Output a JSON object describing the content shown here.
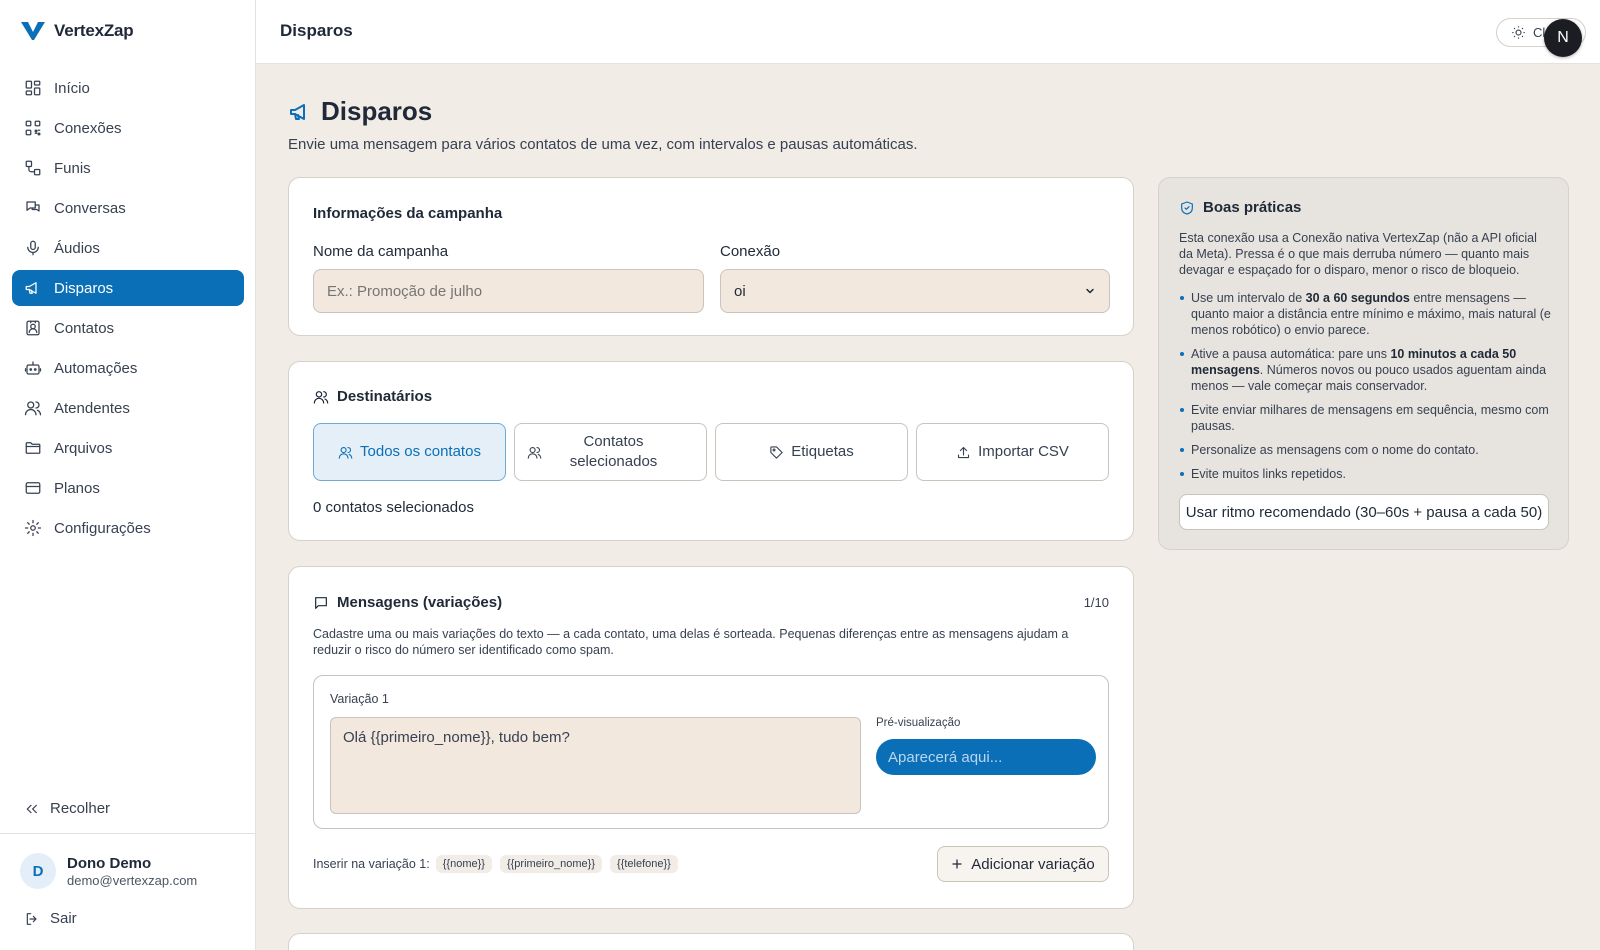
{
  "brand": {
    "name": "VertexZap"
  },
  "sidebar": {
    "items": [
      {
        "label": "Início",
        "icon": "dashboard-icon"
      },
      {
        "label": "Conexões",
        "icon": "qrcode-icon"
      },
      {
        "label": "Funis",
        "icon": "workflow-icon"
      },
      {
        "label": "Conversas",
        "icon": "chat-icon"
      },
      {
        "label": "Áudios",
        "icon": "microphone-icon"
      },
      {
        "label": "Disparos",
        "icon": "megaphone-icon",
        "active": true
      },
      {
        "label": "Contatos",
        "icon": "contact-card-icon"
      },
      {
        "label": "Automações",
        "icon": "bot-icon"
      },
      {
        "label": "Atendentes",
        "icon": "users-icon"
      },
      {
        "label": "Arquivos",
        "icon": "folder-icon"
      },
      {
        "label": "Planos",
        "icon": "credit-card-icon"
      },
      {
        "label": "Configurações",
        "icon": "gear-icon"
      }
    ],
    "collapse_label": "Recolher",
    "user": {
      "initial": "D",
      "name": "Dono Demo",
      "email": "demo@vertexzap.com"
    },
    "logout_label": "Sair"
  },
  "header": {
    "title": "Disparos",
    "theme_button_label": "Cl",
    "user_initial": "N"
  },
  "page": {
    "title": "Disparos",
    "subtitle": "Envie uma mensagem para vários contatos de uma vez, com intervalos e pausas automáticas."
  },
  "campaign": {
    "title": "Informações da campanha",
    "name_label": "Nome da campanha",
    "name_placeholder": "Ex.: Promoção de julho",
    "connection_label": "Conexão",
    "connection_value": "oi"
  },
  "recipients": {
    "title": "Destinatários",
    "options": [
      {
        "label": "Todos os contatos",
        "active": true
      },
      {
        "label": "Contatos selecionados",
        "active": false
      },
      {
        "label": "Etiquetas",
        "active": false
      },
      {
        "label": "Importar CSV",
        "active": false
      }
    ],
    "count_text": "0 contatos selecionados"
  },
  "messages": {
    "title": "Mensagens (variações)",
    "counter": "1/10",
    "description": "Cadastre uma ou mais variações do texto — a cada contato, uma delas é sorteada. Pequenas diferenças entre as mensagens ajudam a reduzir o risco do número ser identificado como spam.",
    "variation_label": "Variação 1",
    "variation_text": "Olá {{primeiro_nome}}, tudo bem?",
    "preview_label": "Pré-visualização",
    "preview_text": "Aparecerá aqui...",
    "insert_label": "Inserir na variação 1:",
    "tokens": [
      "{{nome}}",
      "{{primeiro_nome}}",
      "{{telefone}}"
    ],
    "add_button": "Adicionar variação"
  },
  "tips": {
    "title": "Boas práticas",
    "intro": "Esta conexão usa a Conexão nativa VertexZap (não a API oficial da Meta). Pressa é o que mais derruba número — quanto mais devagar e espaçado for o disparo, menor o risco de bloqueio.",
    "items": [
      {
        "before": "Use um intervalo de ",
        "bold": "30 a 60 segundos",
        "after": " entre mensagens — quanto maior a distância entre mínimo e máximo, mais natural (e menos robótico) o envio parece."
      },
      {
        "before": "Ative a pausa automática: pare uns ",
        "bold": "10 minutos a cada 50 mensagens",
        "after": ". Números novos ou pouco usados aguentam ainda menos — vale começar mais conservador."
      },
      {
        "before": "Evite enviar milhares de mensagens em sequência, mesmo com pausas.",
        "bold": "",
        "after": ""
      },
      {
        "before": "Personalize as mensagens com o nome do contato.",
        "bold": "",
        "after": ""
      },
      {
        "before": "Evite muitos links repetidos.",
        "bold": "",
        "after": ""
      }
    ],
    "button": "Usar ritmo recomendado (30–60s + pausa a cada 50)"
  },
  "colors": {
    "accent": "#0b6fb8",
    "background": "#f1ece6",
    "input_bg": "#f2e8de",
    "panel_bg": "#e7e3df"
  }
}
